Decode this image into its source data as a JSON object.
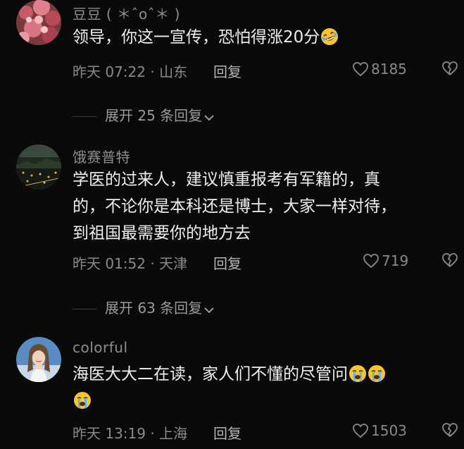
{
  "comments": [
    {
      "username": "豆豆 ( ＊ˆoˆ＊ )",
      "text": "领导，你这一宣传，恐怕得涨20分",
      "emojis": [
        "rofl-emoji"
      ],
      "time": "昨天 07:22",
      "location": "山东",
      "reply_label": "回复",
      "likes": "8185",
      "expand_text": "展开 25 条回复"
    },
    {
      "username": "饿赛普特",
      "text_lines": [
        "学医的过来人，建议慎重报考有军籍的，真",
        "的，不论你是本科还是博士，大家一样对待，",
        "到祖国最需要你的地方去"
      ],
      "time": "昨天 01:52",
      "location": "天津",
      "reply_label": "回复",
      "likes": "719",
      "expand_text": "展开 63 条回复"
    },
    {
      "username": "colorful",
      "text": "海医大大二在读，家人们不懂的尽管问",
      "emojis": [
        "crying-emoji",
        "crying-emoji",
        "crying-emoji"
      ],
      "time": "昨天 13:19",
      "location": "上海",
      "reply_label": "回复",
      "likes": "1503"
    }
  ],
  "icons": {
    "like": "heart-outline-icon",
    "dislike": "broken-heart-icon",
    "expand": "chevron-down-icon"
  },
  "colors": {
    "background": "#0a0a0a",
    "text": "#efefef",
    "secondary": "#8a8a8a",
    "emoji_face": "#f7c531"
  }
}
